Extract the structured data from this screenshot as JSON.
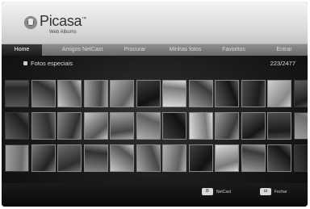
{
  "app": {
    "logo_name": "Picasa",
    "logo_tm": "™",
    "logo_subtitle": "Web Albums"
  },
  "tabs": [
    {
      "label": "Home",
      "active": true
    },
    {
      "label": "Amigos NetCast",
      "active": false
    },
    {
      "label": "Procurar",
      "active": false
    },
    {
      "label": "Minhas fotos",
      "active": false
    },
    {
      "label": "Favoritos",
      "active": false
    },
    {
      "label": "Entrar",
      "active": false
    }
  ],
  "section": {
    "title": "Fotos especiais",
    "counter": "223/2477"
  },
  "footer": {
    "netcast_key": "B",
    "netcast_label": "NetCast",
    "close_key": "◘",
    "close_label": "Fechar"
  },
  "colors": {
    "header_bg": "#dcdcdc",
    "tabbar_bg": "#7a7a7a",
    "active_tab_bg": "#1a1a1a",
    "content_bg": "#1a1a1a",
    "text_light": "#dddddd"
  }
}
